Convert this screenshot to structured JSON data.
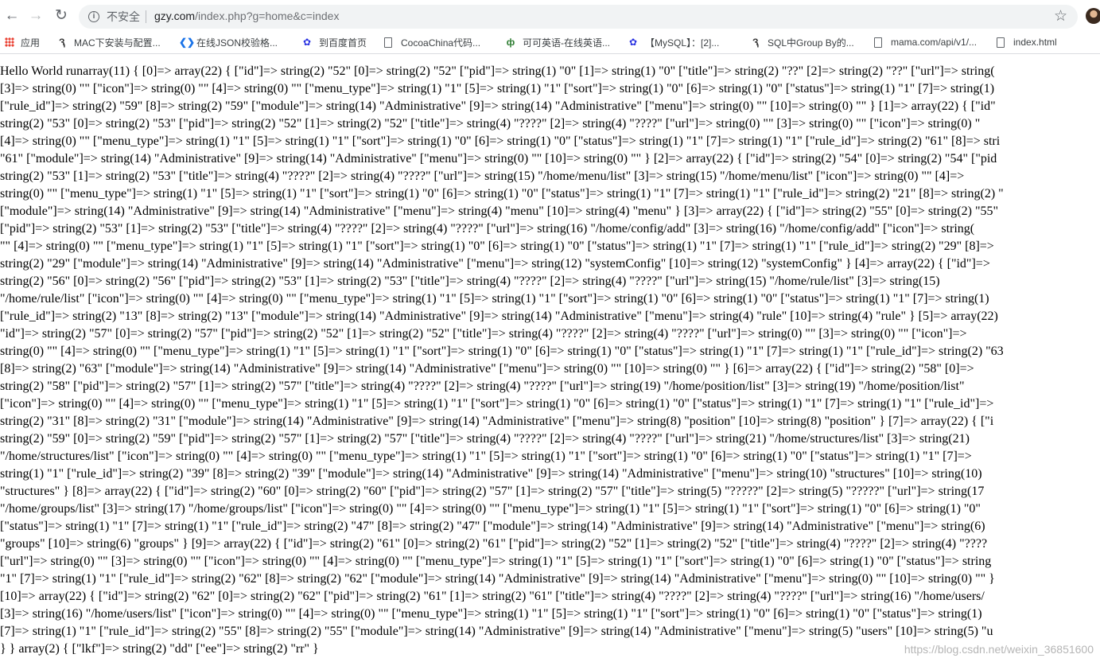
{
  "browser": {
    "security_label": "不安全",
    "url_host": "gzy.com",
    "url_path": "/index.php?g=home&c=index"
  },
  "bookmarks": [
    {
      "label": "应用",
      "icon": "apps-grid-icon"
    },
    {
      "label": "MAC下安装与配置...",
      "icon": "site-icon"
    },
    {
      "label": "在线JSON校验格...",
      "icon": "json-icon"
    },
    {
      "label": "到百度首页",
      "icon": "baidu-paw-icon"
    },
    {
      "label": "CocoaChina代码...",
      "icon": "page-icon"
    },
    {
      "label": "可可英语-在线英语...",
      "icon": "kekenet-icon"
    },
    {
      "label": "【MySQL】：[2]...",
      "icon": "baidu-paw-icon"
    },
    {
      "label": "SQL中Group By的...",
      "icon": "site-icon"
    },
    {
      "label": "mama.com/api/v1/...",
      "icon": "page-icon"
    },
    {
      "label": "index.html",
      "icon": "page-icon"
    }
  ],
  "page": {
    "lines": [
      "Hello World runarray(11) { [0]=> array(22) { [\"id\"]=> string(2) \"52\" [0]=> string(2) \"52\" [\"pid\"]=> string(1) \"0\" [1]=> string(1) \"0\" [\"title\"]=> string(2) \"??\" [2]=> string(2) \"??\" [\"url\"]=> string(",
      "[3]=> string(0) \"\" [\"icon\"]=> string(0) \"\" [4]=> string(0) \"\" [\"menu_type\"]=> string(1) \"1\" [5]=> string(1) \"1\" [\"sort\"]=> string(1) \"0\" [6]=> string(1) \"0\" [\"status\"]=> string(1) \"1\" [7]=> string(1)",
      "[\"rule_id\"]=> string(2) \"59\" [8]=> string(2) \"59\" [\"module\"]=> string(14) \"Administrative\" [9]=> string(14) \"Administrative\" [\"menu\"]=> string(0) \"\" [10]=> string(0) \"\" } [1]=> array(22) { [\"id\"",
      "string(2) \"53\" [0]=> string(2) \"53\" [\"pid\"]=> string(2) \"52\" [1]=> string(2) \"52\" [\"title\"]=> string(4) \"????\" [2]=> string(4) \"????\" [\"url\"]=> string(0) \"\" [3]=> string(0) \"\" [\"icon\"]=> string(0) \"",
      "[4]=> string(0) \"\" [\"menu_type\"]=> string(1) \"1\" [5]=> string(1) \"1\" [\"sort\"]=> string(1) \"0\" [6]=> string(1) \"0\" [\"status\"]=> string(1) \"1\" [7]=> string(1) \"1\" [\"rule_id\"]=> string(2) \"61\" [8]=> stri",
      "\"61\" [\"module\"]=> string(14) \"Administrative\" [9]=> string(14) \"Administrative\" [\"menu\"]=> string(0) \"\" [10]=> string(0) \"\" } [2]=> array(22) { [\"id\"]=> string(2) \"54\" [0]=> string(2) \"54\" [\"pid",
      "string(2) \"53\" [1]=> string(2) \"53\" [\"title\"]=> string(4) \"????\" [2]=> string(4) \"????\" [\"url\"]=> string(15) \"/home/menu/list\" [3]=> string(15) \"/home/menu/list\" [\"icon\"]=> string(0) \"\" [4]=>",
      "string(0) \"\" [\"menu_type\"]=> string(1) \"1\" [5]=> string(1) \"1\" [\"sort\"]=> string(1) \"0\" [6]=> string(1) \"0\" [\"status\"]=> string(1) \"1\" [7]=> string(1) \"1\" [\"rule_id\"]=> string(2) \"21\" [8]=> string(2) \"",
      "[\"module\"]=> string(14) \"Administrative\" [9]=> string(14) \"Administrative\" [\"menu\"]=> string(4) \"menu\" [10]=> string(4) \"menu\" } [3]=> array(22) { [\"id\"]=> string(2) \"55\" [0]=> string(2) \"55\"",
      "[\"pid\"]=> string(2) \"53\" [1]=> string(2) \"53\" [\"title\"]=> string(4) \"????\" [2]=> string(4) \"????\" [\"url\"]=> string(16) \"/home/config/add\" [3]=> string(16) \"/home/config/add\" [\"icon\"]=> string(",
      "\"\" [4]=> string(0) \"\" [\"menu_type\"]=> string(1) \"1\" [5]=> string(1) \"1\" [\"sort\"]=> string(1) \"0\" [6]=> string(1) \"0\" [\"status\"]=> string(1) \"1\" [7]=> string(1) \"1\" [\"rule_id\"]=> string(2) \"29\" [8]=>",
      "string(2) \"29\" [\"module\"]=> string(14) \"Administrative\" [9]=> string(14) \"Administrative\" [\"menu\"]=> string(12) \"systemConfig\" [10]=> string(12) \"systemConfig\" } [4]=> array(22) { [\"id\"]=>",
      "string(2) \"56\" [0]=> string(2) \"56\" [\"pid\"]=> string(2) \"53\" [1]=> string(2) \"53\" [\"title\"]=> string(4) \"????\" [2]=> string(4) \"????\" [\"url\"]=> string(15) \"/home/rule/list\" [3]=> string(15)",
      "\"/home/rule/list\" [\"icon\"]=> string(0) \"\" [4]=> string(0) \"\" [\"menu_type\"]=> string(1) \"1\" [5]=> string(1) \"1\" [\"sort\"]=> string(1) \"0\" [6]=> string(1) \"0\" [\"status\"]=> string(1) \"1\" [7]=> string(1)",
      "[\"rule_id\"]=> string(2) \"13\" [8]=> string(2) \"13\" [\"module\"]=> string(14) \"Administrative\" [9]=> string(14) \"Administrative\" [\"menu\"]=> string(4) \"rule\" [10]=> string(4) \"rule\" } [5]=> array(22)",
      "\"id\"]=> string(2) \"57\" [0]=> string(2) \"57\" [\"pid\"]=> string(2) \"52\" [1]=> string(2) \"52\" [\"title\"]=> string(4) \"????\" [2]=> string(4) \"????\" [\"url\"]=> string(0) \"\" [3]=> string(0) \"\" [\"icon\"]=>",
      "string(0) \"\" [4]=> string(0) \"\" [\"menu_type\"]=> string(1) \"1\" [5]=> string(1) \"1\" [\"sort\"]=> string(1) \"0\" [6]=> string(1) \"0\" [\"status\"]=> string(1) \"1\" [7]=> string(1) \"1\" [\"rule_id\"]=> string(2) \"63",
      "[8]=> string(2) \"63\" [\"module\"]=> string(14) \"Administrative\" [9]=> string(14) \"Administrative\" [\"menu\"]=> string(0) \"\" [10]=> string(0) \"\" } [6]=> array(22) { [\"id\"]=> string(2) \"58\" [0]=>",
      "string(2) \"58\" [\"pid\"]=> string(2) \"57\" [1]=> string(2) \"57\" [\"title\"]=> string(4) \"????\" [2]=> string(4) \"????\" [\"url\"]=> string(19) \"/home/position/list\" [3]=> string(19) \"/home/position/list\"",
      "[\"icon\"]=> string(0) \"\" [4]=> string(0) \"\" [\"menu_type\"]=> string(1) \"1\" [5]=> string(1) \"1\" [\"sort\"]=> string(1) \"0\" [6]=> string(1) \"0\" [\"status\"]=> string(1) \"1\" [7]=> string(1) \"1\" [\"rule_id\"]=>",
      "string(2) \"31\" [8]=> string(2) \"31\" [\"module\"]=> string(14) \"Administrative\" [9]=> string(14) \"Administrative\" [\"menu\"]=> string(8) \"position\" [10]=> string(8) \"position\" } [7]=> array(22) { [\"i",
      "string(2) \"59\" [0]=> string(2) \"59\" [\"pid\"]=> string(2) \"57\" [1]=> string(2) \"57\" [\"title\"]=> string(4) \"????\" [2]=> string(4) \"????\" [\"url\"]=> string(21) \"/home/structures/list\" [3]=> string(21)",
      "\"/home/structures/list\" [\"icon\"]=> string(0) \"\" [4]=> string(0) \"\" [\"menu_type\"]=> string(1) \"1\" [5]=> string(1) \"1\" [\"sort\"]=> string(1) \"0\" [6]=> string(1) \"0\" [\"status\"]=> string(1) \"1\" [7]=>",
      "string(1) \"1\" [\"rule_id\"]=> string(2) \"39\" [8]=> string(2) \"39\" [\"module\"]=> string(14) \"Administrative\" [9]=> string(14) \"Administrative\" [\"menu\"]=> string(10) \"structures\" [10]=> string(10)",
      "\"structures\" } [8]=> array(22) { [\"id\"]=> string(2) \"60\" [0]=> string(2) \"60\" [\"pid\"]=> string(2) \"57\" [1]=> string(2) \"57\" [\"title\"]=> string(5) \"?????\" [2]=> string(5) \"?????\" [\"url\"]=> string(17",
      "\"/home/groups/list\" [3]=> string(17) \"/home/groups/list\" [\"icon\"]=> string(0) \"\" [4]=> string(0) \"\" [\"menu_type\"]=> string(1) \"1\" [5]=> string(1) \"1\" [\"sort\"]=> string(1) \"0\" [6]=> string(1) \"0\"",
      "[\"status\"]=> string(1) \"1\" [7]=> string(1) \"1\" [\"rule_id\"]=> string(2) \"47\" [8]=> string(2) \"47\" [\"module\"]=> string(14) \"Administrative\" [9]=> string(14) \"Administrative\" [\"menu\"]=> string(6)",
      "\"groups\" [10]=> string(6) \"groups\" } [9]=> array(22) { [\"id\"]=> string(2) \"61\" [0]=> string(2) \"61\" [\"pid\"]=> string(2) \"52\" [1]=> string(2) \"52\" [\"title\"]=> string(4) \"????\" [2]=> string(4) \"????",
      "[\"url\"]=> string(0) \"\" [3]=> string(0) \"\" [\"icon\"]=> string(0) \"\" [4]=> string(0) \"\" [\"menu_type\"]=> string(1) \"1\" [5]=> string(1) \"1\" [\"sort\"]=> string(1) \"0\" [6]=> string(1) \"0\" [\"status\"]=> string",
      "\"1\" [7]=> string(1) \"1\" [\"rule_id\"]=> string(2) \"62\" [8]=> string(2) \"62\" [\"module\"]=> string(14) \"Administrative\" [9]=> string(14) \"Administrative\" [\"menu\"]=> string(0) \"\" [10]=> string(0) \"\" }",
      "[10]=> array(22) { [\"id\"]=> string(2) \"62\" [0]=> string(2) \"62\" [\"pid\"]=> string(2) \"61\" [1]=> string(2) \"61\" [\"title\"]=> string(4) \"????\" [2]=> string(4) \"????\" [\"url\"]=> string(16) \"/home/users/",
      "[3]=> string(16) \"/home/users/list\" [\"icon\"]=> string(0) \"\" [4]=> string(0) \"\" [\"menu_type\"]=> string(1) \"1\" [5]=> string(1) \"1\" [\"sort\"]=> string(1) \"0\" [6]=> string(1) \"0\" [\"status\"]=> string(1)",
      "[7]=> string(1) \"1\" [\"rule_id\"]=> string(2) \"55\" [8]=> string(2) \"55\" [\"module\"]=> string(14) \"Administrative\" [9]=> string(14) \"Administrative\" [\"menu\"]=> string(5) \"users\" [10]=> string(5) \"u",
      "} } array(2) { [\"lkf\"]=> string(2) \"dd\" [\"ee\"]=> string(2) \"rr\" }"
    ],
    "watermark": "https://blog.csdn.net/weixin_36851600"
  }
}
